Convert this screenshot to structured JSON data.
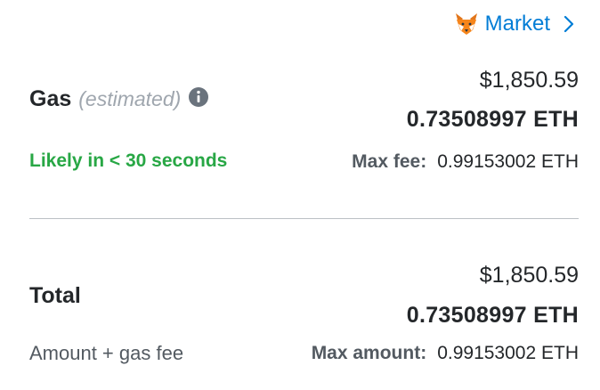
{
  "market": {
    "label": "Market",
    "icon": "fox-icon",
    "color": "#037dd6"
  },
  "gas": {
    "title": "Gas",
    "qualifier": "(estimated)",
    "info_icon": "info-icon",
    "fiat": "$1,850.59",
    "eth": "0.73508997 ETH",
    "timing": "Likely in < 30 seconds",
    "timing_color": "#28a745",
    "max_fee_label": "Max fee:",
    "max_fee_value": "0.99153002 ETH"
  },
  "total": {
    "title": "Total",
    "subtitle": "Amount + gas fee",
    "fiat": "$1,850.59",
    "eth": "0.73508997 ETH",
    "max_amount_label": "Max amount:",
    "max_amount_value": "0.99153002 ETH"
  }
}
